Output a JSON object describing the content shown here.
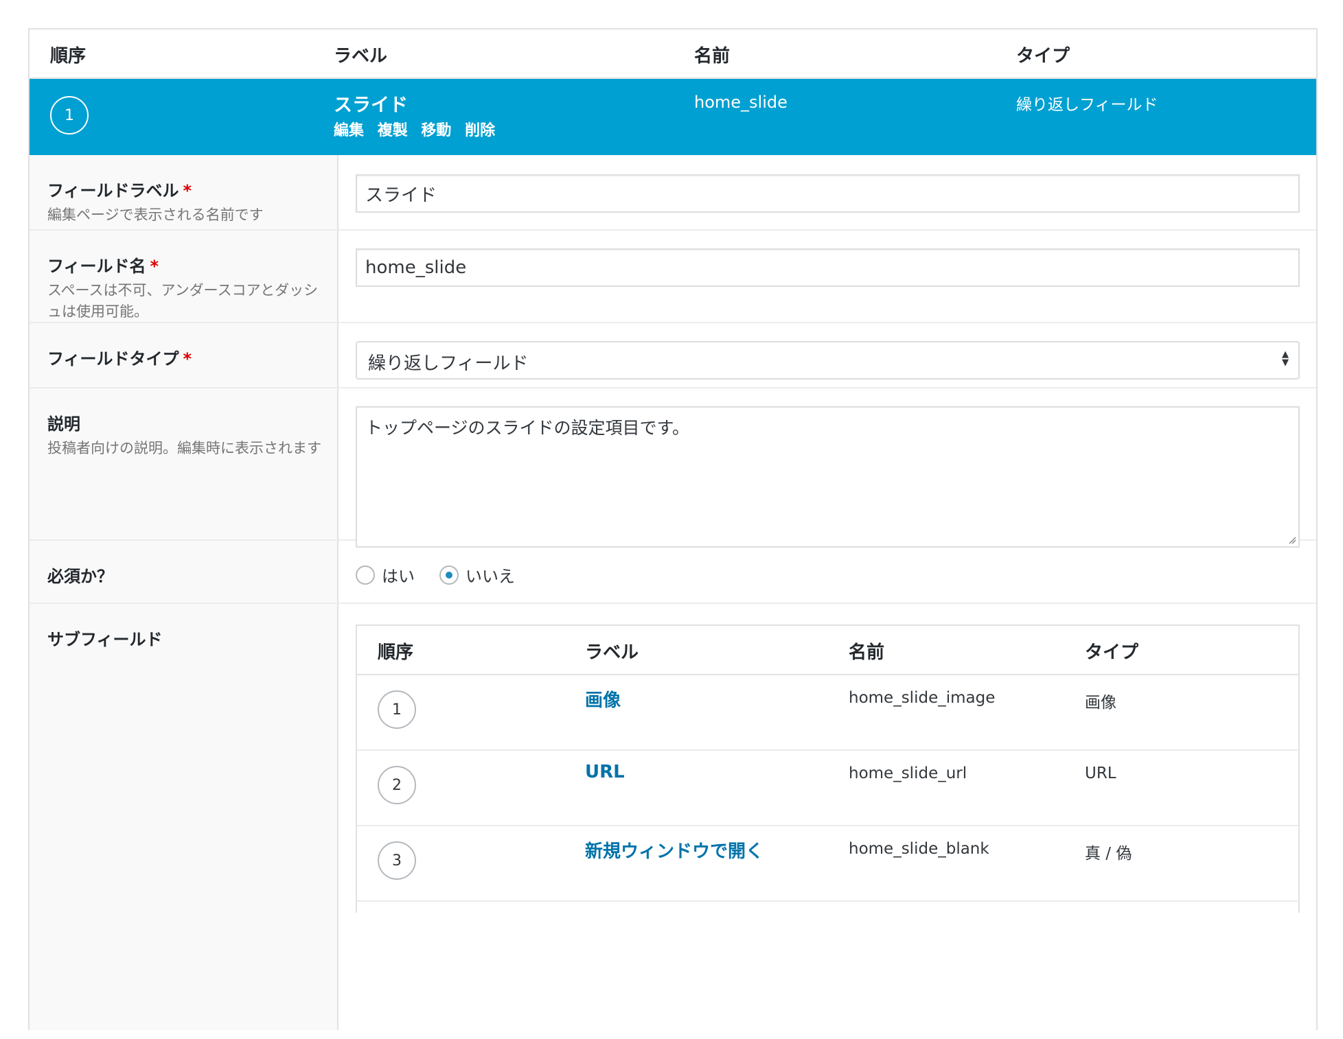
{
  "main_table": {
    "headers": {
      "order": "順序",
      "label": "ラベル",
      "name": "名前",
      "type": "タイプ"
    },
    "field": {
      "order": "1",
      "label": "スライド",
      "actions": [
        "編集",
        "複製",
        "移動",
        "削除"
      ],
      "name": "home_slide",
      "type": "繰り返しフィールド"
    }
  },
  "settings": {
    "field_label": {
      "label": "フィールドラベル",
      "required_mark": "*",
      "description": "編集ページで表示される名前です",
      "value": "スライド"
    },
    "field_name": {
      "label": "フィールド名",
      "required_mark": "*",
      "description": "スペースは不可、アンダースコアとダッシュは使用可能。",
      "value": "home_slide"
    },
    "field_type": {
      "label": "フィールドタイプ",
      "required_mark": "*",
      "selected": "繰り返しフィールド"
    },
    "instructions": {
      "label": "説明",
      "description": "投稿者向けの説明。編集時に表示されます",
      "value": "トップページのスライドの設定項目です。"
    },
    "required": {
      "label": "必須か？",
      "options": [
        "はい",
        "いいえ"
      ],
      "selected": "いいえ"
    },
    "sub_fields": {
      "label": "サブフィールド",
      "headers": {
        "order": "順序",
        "label": "ラベル",
        "name": "名前",
        "type": "タイプ"
      },
      "rows": [
        {
          "order": "1",
          "label": "画像",
          "name": "home_slide_image",
          "type": "画像"
        },
        {
          "order": "2",
          "label": "URL",
          "name": "home_slide_url",
          "type": "URL"
        },
        {
          "order": "3",
          "label": "新規ウィンドウで開く",
          "name": "home_slide_blank",
          "type": "真 / 偽"
        }
      ]
    }
  },
  "colors": {
    "selected_row": "#00a0d2",
    "link": "#0073aa",
    "required": "#dd0000",
    "radio_checked": "#1e8cbe"
  }
}
